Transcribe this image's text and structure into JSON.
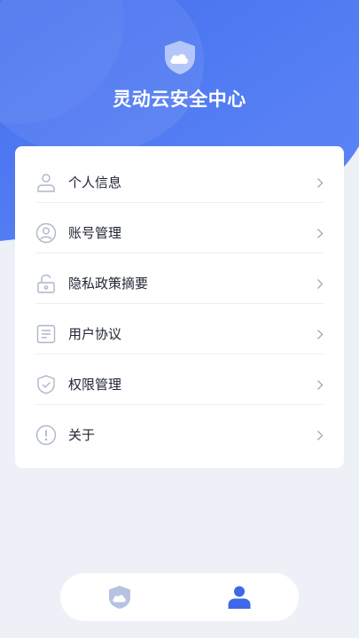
{
  "header": {
    "title": "灵动云安全中心",
    "logo_icon": "cloud-shield-icon",
    "gradient_colors": [
      "#4A74F0",
      "#5C86F5"
    ]
  },
  "menu": {
    "items": [
      {
        "label": "个人信息",
        "icon": "person-icon"
      },
      {
        "label": "账号管理",
        "icon": "account-icon"
      },
      {
        "label": "隐私政策摘要",
        "icon": "lock-icon"
      },
      {
        "label": "用户协议",
        "icon": "document-icon"
      },
      {
        "label": "权限管理",
        "icon": "shield-check-icon"
      },
      {
        "label": "关于",
        "icon": "info-icon"
      }
    ],
    "chevron_icon": "chevron-right-icon"
  },
  "tabbar": {
    "tabs": [
      {
        "icon": "cloud-shield-icon",
        "active": false
      },
      {
        "icon": "user-icon",
        "active": true
      }
    ],
    "active_color": "#3D68E8",
    "inactive_color": "#B7C2E0"
  }
}
